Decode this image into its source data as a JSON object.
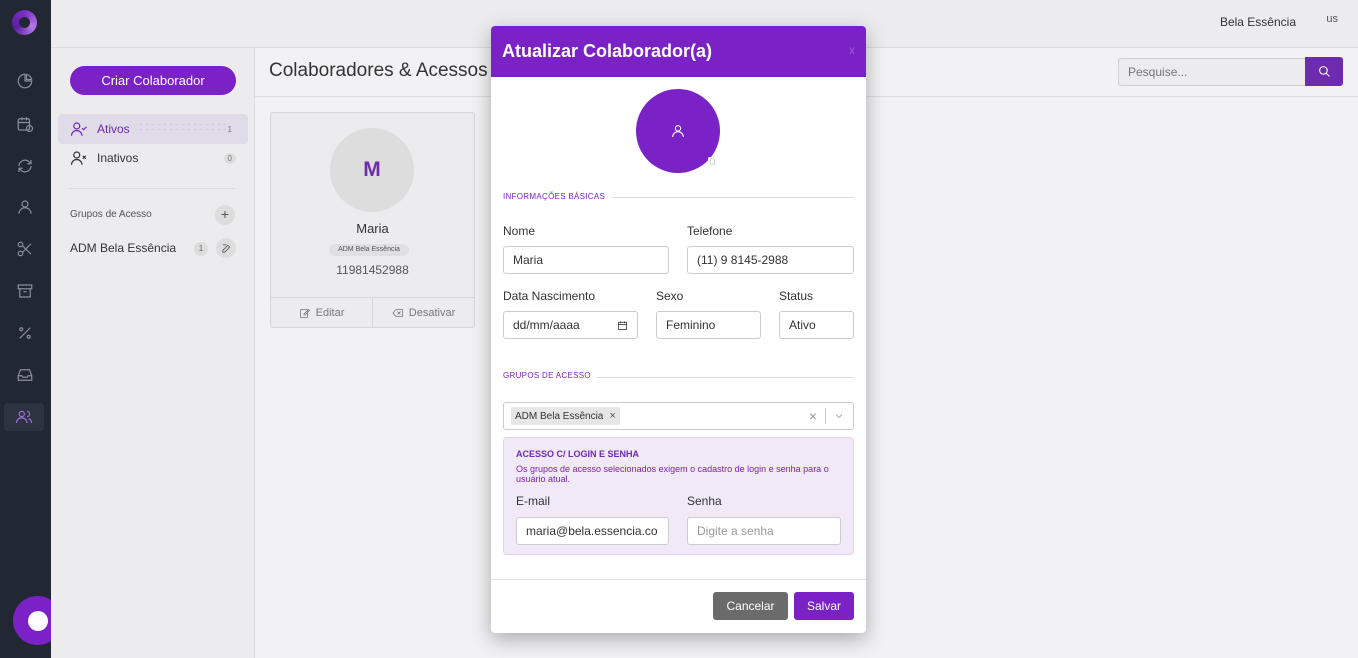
{
  "topbar": {
    "company": "Bela Essência",
    "avatar_alt": "us"
  },
  "sidebar": {
    "create_button": "Criar Colaborador",
    "items": [
      {
        "label": "Ativos",
        "count": "1"
      },
      {
        "label": "Inativos",
        "count": "0"
      }
    ],
    "groups_label": "Grupos de Acesso",
    "groups_add": "+",
    "groups": [
      {
        "label": "ADM Bela Essência",
        "count": "1"
      }
    ]
  },
  "main": {
    "title": "Colaboradores & Acessos",
    "search": {
      "placeholder": "Pesquise..."
    },
    "card": {
      "initial": "M",
      "name": "Maria",
      "badge": "ADM Bela Essência",
      "phone": "11981452988",
      "edit_label": "Editar",
      "deactivate_label": "Desativar"
    }
  },
  "modal": {
    "title": "Atualizar Colaborador(a)",
    "close": "x",
    "section_basic": "INFORMAÇÕES BÁSICAS",
    "name_label": "Nome",
    "name_value": "Maria",
    "phone_label": "Telefone",
    "phone_value": "(11) 9 8145-2988",
    "birth_label": "Data Nascimento",
    "birth_value": "dd/mm/aaaa",
    "sex_label": "Sexo",
    "sex_value": "Feminino",
    "status_label": "Status",
    "status_value": "Ativo",
    "section_groups": "GRUPOS DE ACESSO",
    "selected_group": "ADM Bela Essência",
    "chip_remove": "×",
    "clear_all": "×",
    "login": {
      "title": "ACESSO C/ LOGIN E SENHA",
      "description": "Os grupos de acesso selecionados exigem o cadastro de login e senha para o usuário atual.",
      "email_label": "E-mail",
      "email_value": "maria@bela.essencia.co",
      "password_label": "Senha",
      "password_placeholder": "Digite a senha"
    },
    "cancel": "Cancelar",
    "save": "Salvar"
  },
  "colors": {
    "primary": "#7a22c6",
    "rail": "#212733"
  },
  "icons": [
    "chart-icon",
    "calendar-icon",
    "refresh-icon",
    "user-icon",
    "scissors-icon",
    "box-icon",
    "percent-icon",
    "inbox-icon",
    "users-icon"
  ]
}
